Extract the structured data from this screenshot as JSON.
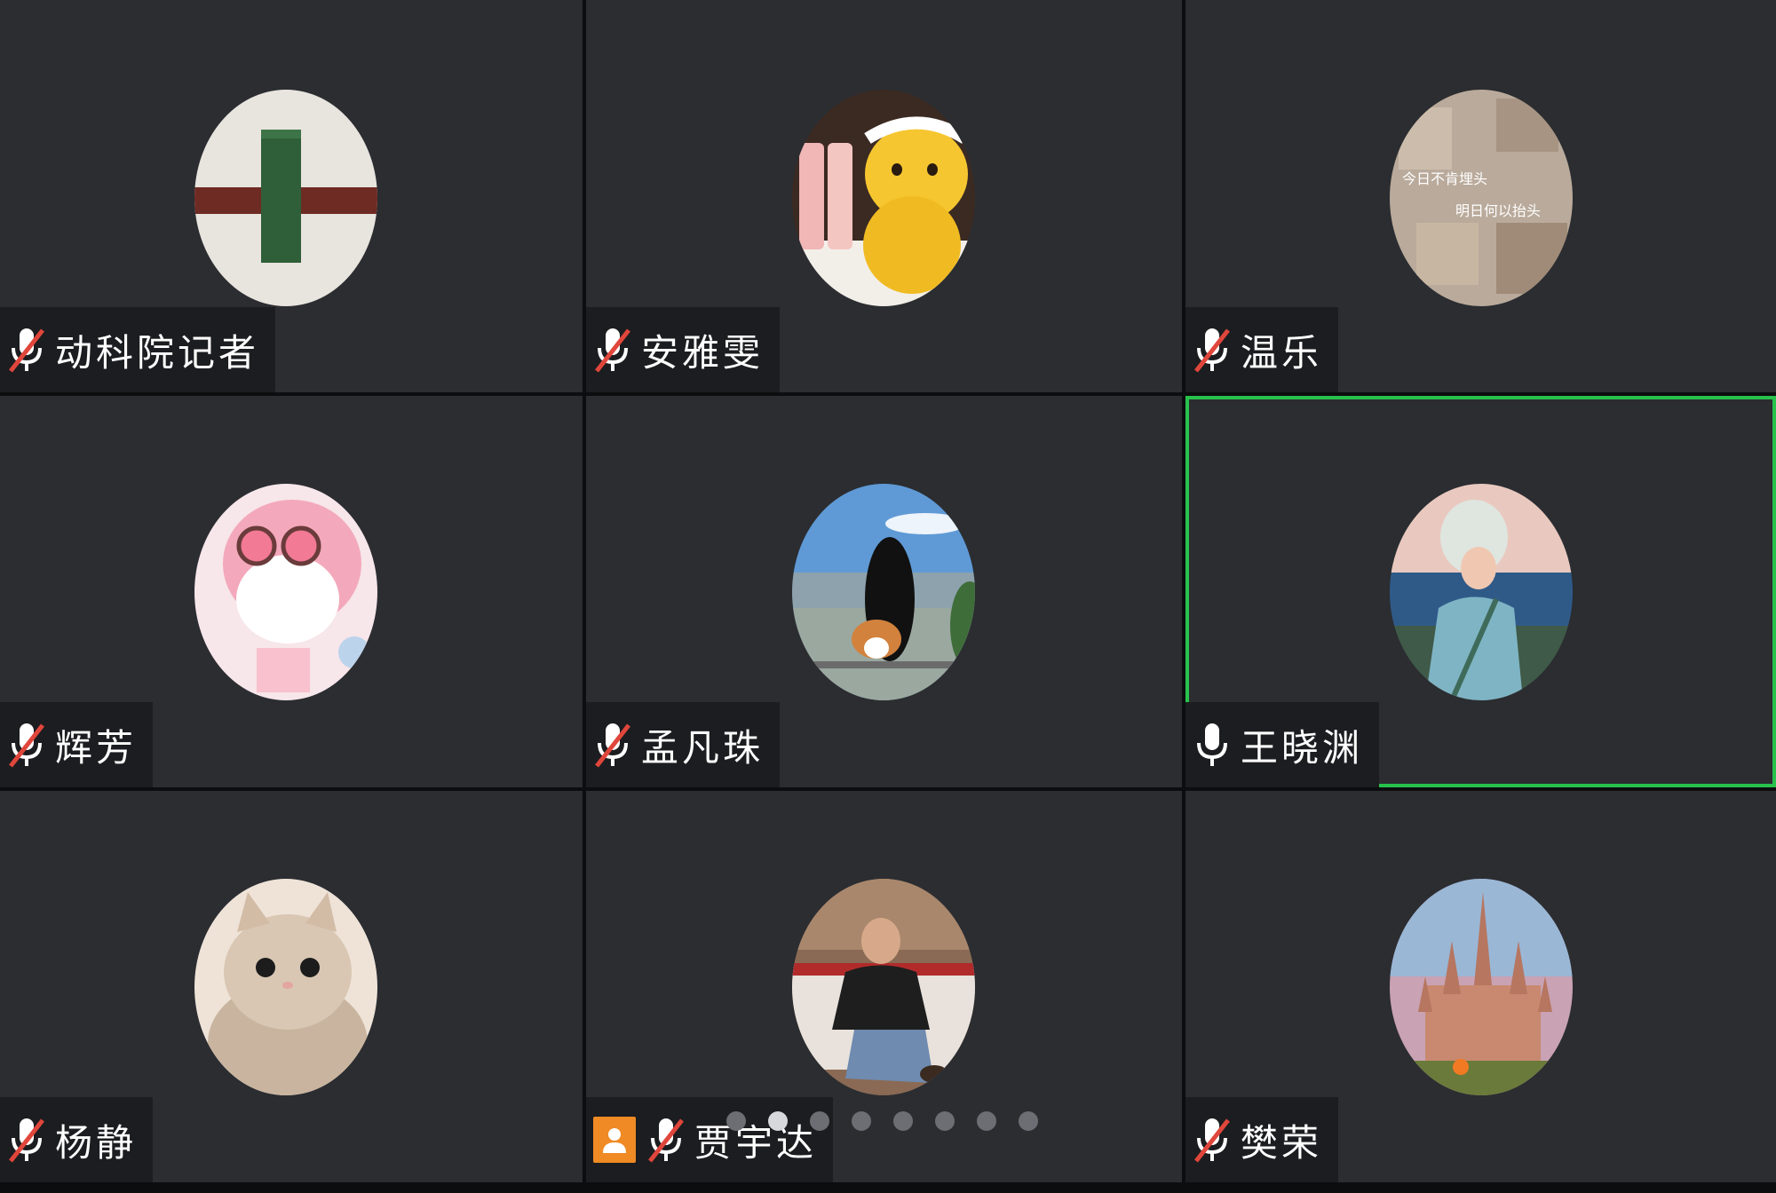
{
  "participants": [
    {
      "name": "动科院记者",
      "muted": true,
      "avatar": "lego-block"
    },
    {
      "name": "安雅雯",
      "muted": true,
      "avatar": "winnie-bear"
    },
    {
      "name": "温乐",
      "muted": true,
      "avatar": "collage",
      "avatar_text": [
        "今日不肯埋头",
        "明日何以抬头"
      ]
    },
    {
      "name": "辉芳",
      "muted": true,
      "avatar": "pink-cartoon"
    },
    {
      "name": "孟凡珠",
      "muted": true,
      "avatar": "girl-corgi"
    },
    {
      "name": "王晓渊",
      "muted": false,
      "active_speaker": true,
      "avatar": "anime-boy"
    },
    {
      "name": "杨静",
      "muted": true,
      "avatar": "cat"
    },
    {
      "name": "贾宇达",
      "muted": true,
      "host": true,
      "avatar": "man-on-couch"
    },
    {
      "name": "樊荣",
      "muted": true,
      "avatar": "castle"
    }
  ],
  "pager": {
    "total_pages": 8,
    "current_page": 2
  },
  "colors": {
    "tile_bg": "#2b2d31",
    "active_border": "#27c24c",
    "muted_slash": "#e0463b",
    "host_badge": "#f08a24"
  },
  "icons": {
    "muted": "mic-muted-icon",
    "unmuted": "mic-icon",
    "host": "host-icon"
  }
}
